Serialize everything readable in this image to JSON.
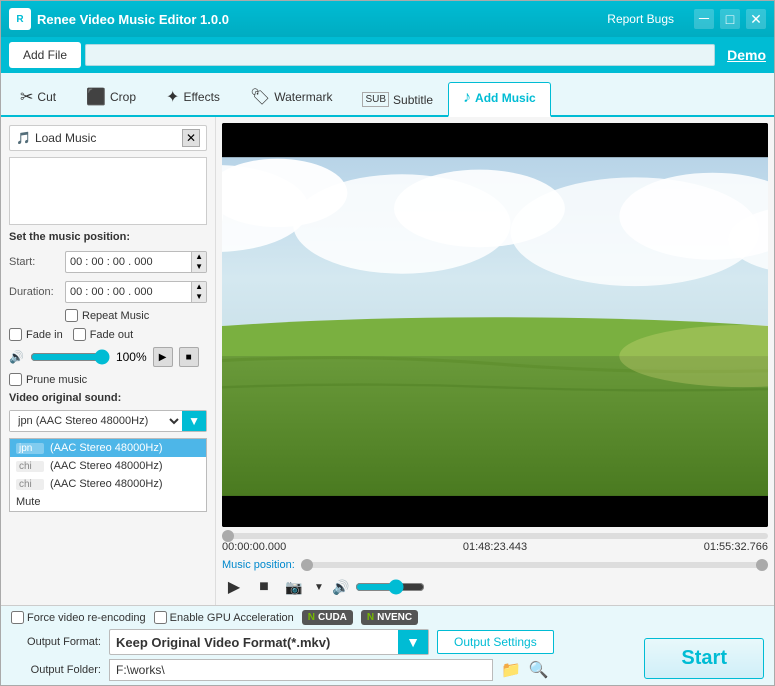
{
  "window": {
    "title": "Renee Video Music Editor 1.0.0",
    "report_bugs": "Report Bugs",
    "demo": "Demo"
  },
  "toolbar": {
    "add_file": "Add File",
    "file_path": ""
  },
  "tabs": [
    {
      "id": "cut",
      "label": "Cut",
      "icon": "✂"
    },
    {
      "id": "crop",
      "label": "Crop",
      "icon": "⬜"
    },
    {
      "id": "effects",
      "label": "Effects",
      "icon": "✦"
    },
    {
      "id": "watermark",
      "label": "Watermark",
      "icon": "⬛"
    },
    {
      "id": "subtitle",
      "label": "Subtitle",
      "icon": "SUB"
    },
    {
      "id": "add_music",
      "label": "Add Music",
      "icon": "♪"
    }
  ],
  "left_panel": {
    "load_music_label": "Load Music",
    "set_music_position": "Set the music position:",
    "start_label": "Start:",
    "start_value": "00 : 00 : 00 . 000",
    "duration_label": "Duration:",
    "duration_value": "00 : 00 : 00 . 000",
    "repeat_music": "Repeat Music",
    "fade_in": "Fade in",
    "fade_out": "Fade out",
    "volume": "100%",
    "prune_music": "Prune music",
    "video_original_sound": "Video original sound:",
    "dropdown_selected": "jpn  (AAC Stereo 48000Hz)",
    "dropdown_items": [
      {
        "tag": "jpn",
        "label": "(AAC Stereo 48000Hz)",
        "selected": true
      },
      {
        "tag": "chi",
        "label": "(AAC Stereo 48000Hz)",
        "selected": false
      },
      {
        "tag": "chi",
        "label": "(AAC Stereo 48000Hz)",
        "selected": false
      }
    ],
    "mute": "Mute"
  },
  "video_panel": {
    "time_start": "00:00:00.000",
    "time_mid": "01:48:23.443",
    "time_end": "01:55:32.766",
    "music_position_label": "Music position:"
  },
  "bottom": {
    "force_encoding_label": "Force video re-encoding",
    "enable_gpu_label": "Enable GPU Acceleration",
    "cuda_label": "CUDA",
    "nvenc_label": "NVENC",
    "output_format_label": "Output Format:",
    "output_format_value": "Keep Original Video Format(*.mkv)",
    "output_settings_label": "Output Settings",
    "output_folder_label": "Output Folder:",
    "output_folder_value": "F:\\works\\",
    "start_label": "Start"
  }
}
